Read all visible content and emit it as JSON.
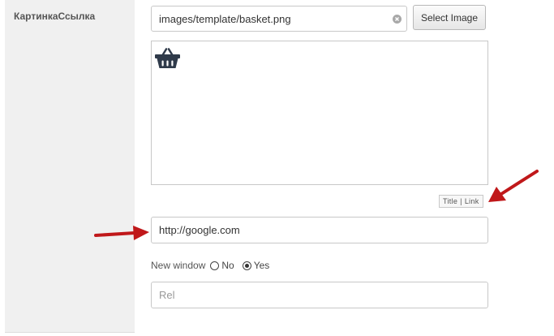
{
  "field": {
    "label": "КартинкаСсылка"
  },
  "image": {
    "path_value": "images/template/basket.png",
    "select_label": "Select Image",
    "preview_icon": "basket-icon"
  },
  "toggle": {
    "title": "Title",
    "separator": "|",
    "link": "Link"
  },
  "link": {
    "value": "http://google.com"
  },
  "new_window": {
    "label": "New window",
    "options": [
      "No",
      "Yes"
    ],
    "selected": "Yes"
  },
  "rel": {
    "placeholder": "Rel",
    "value": ""
  },
  "colors": {
    "arrow": "#c0181a",
    "icon": "#2f3a4a"
  }
}
